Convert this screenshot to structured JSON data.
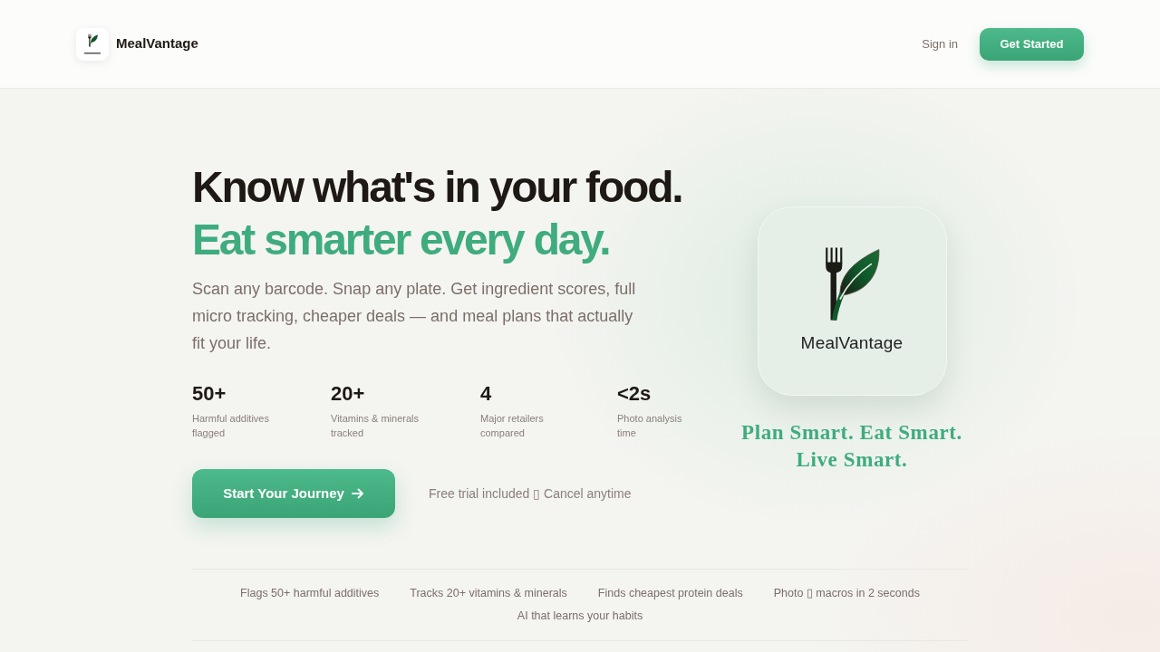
{
  "header": {
    "brand": "MealVantage",
    "sign_in": "Sign in",
    "cta": "Get Started"
  },
  "hero": {
    "headline": "Know what's in your food.",
    "headline_accent": "Eat smarter every day.",
    "description": "Scan any barcode. Snap any plate. Get ingredient scores, full micro tracking, cheaper deals — and meal plans that actually fit your life.",
    "stats": [
      {
        "value": "50+",
        "label": "Harmful additives flagged"
      },
      {
        "value": "20+",
        "label": "Vitamins & minerals tracked"
      },
      {
        "value": "4",
        "label": "Major retailers compared"
      },
      {
        "value": "<2s",
        "label": "Photo analysis time"
      }
    ],
    "cta": "Start Your Journey",
    "note": "Free trial included ▯ Cancel anytime"
  },
  "showcase": {
    "wordmark": "MealVantage",
    "tagline": "Plan Smart. Eat Smart. Live Smart."
  },
  "features": [
    "Flags 50+ harmful additives",
    "Tracks 20+ vitamins & minerals",
    "Finds cheapest protein deals",
    "Photo ▯ macros in 2 seconds",
    "AI that learns your habits"
  ]
}
